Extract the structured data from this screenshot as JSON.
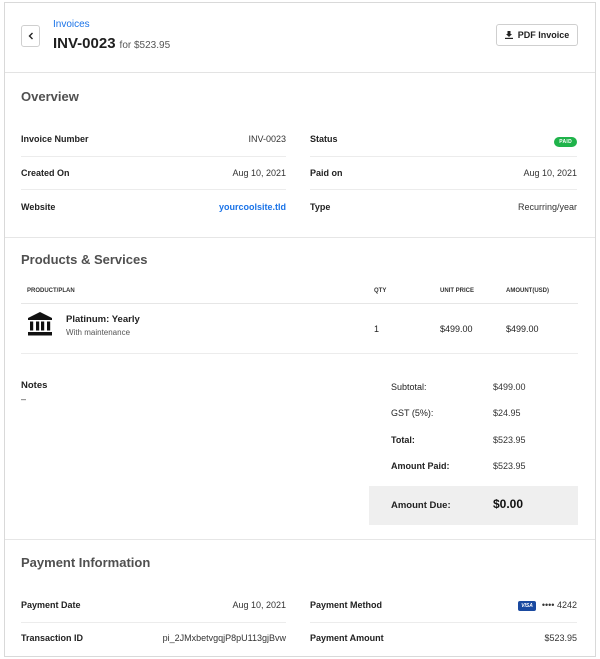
{
  "header": {
    "breadcrumb": "Invoices",
    "invoice_number": "INV-0023",
    "for_text": "for $523.95",
    "pdf_button": "PDF Invoice"
  },
  "overview": {
    "title": "Overview",
    "invoice_number_label": "Invoice Number",
    "invoice_number_value": "INV-0023",
    "created_label": "Created On",
    "created_value": "Aug 10, 2021",
    "website_label": "Website",
    "website_value": "yourcoolsite.tld",
    "status_label": "Status",
    "status_value": "PAID",
    "paid_on_label": "Paid on",
    "paid_on_value": "Aug 10, 2021",
    "type_label": "Type",
    "type_value": "Recurring/year"
  },
  "products": {
    "title": "Products & Services",
    "columns": [
      "PRODUCT/PLAN",
      "QTY",
      "UNIT PRICE",
      "AMOUNT(USD)"
    ],
    "items": [
      {
        "icon": "bank-icon",
        "name": "Platinum: Yearly",
        "subtitle": "With maintenance",
        "qty": "1",
        "unit_price": "$499.00",
        "amount": "$499.00"
      }
    ]
  },
  "notes": {
    "label": "Notes",
    "value": "–"
  },
  "summary": {
    "subtotal_label": "Subtotal:",
    "subtotal_value": "$499.00",
    "gst_label": "GST (5%):",
    "gst_value": "$24.95",
    "total_label": "Total:",
    "total_value": "$523.95",
    "amount_paid_label": "Amount Paid:",
    "amount_paid_value": "$523.95",
    "amount_due_label": "Amount Due:",
    "amount_due_value": "$0.00"
  },
  "payment": {
    "title": "Payment Information",
    "date_label": "Payment Date",
    "date_value": "Aug 10, 2021",
    "txn_label": "Transaction ID",
    "txn_value": "pi_2JMxbetvgqjP8pU113gjBvw",
    "method_label": "Payment Method",
    "card_brand": "VISA",
    "card_last4": "•••• 4242",
    "amount_label": "Payment Amount",
    "amount_value": "$523.95"
  },
  "colors": {
    "accent": "#1a73e8",
    "paid_badge": "#1fb34a",
    "visa": "#1a4aa0"
  }
}
